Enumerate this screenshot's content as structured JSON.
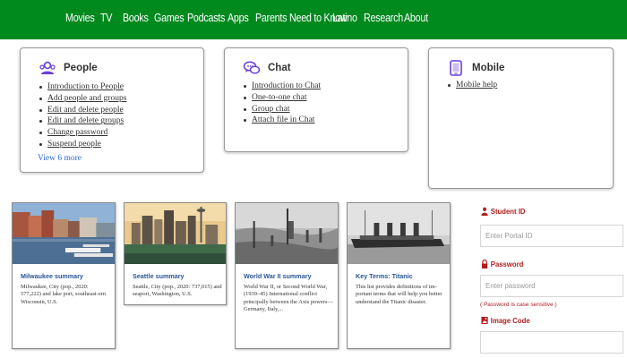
{
  "nav": {
    "items": [
      "Movies",
      "TV",
      "Books",
      "Games",
      "Podcasts",
      "Apps",
      "Parents Need to Know",
      "Latino",
      "Research",
      "About"
    ],
    "background": "#008a1e"
  },
  "help_cards": [
    {
      "title": "People",
      "icon": "people-icon",
      "links": [
        "Introduction to People",
        "Add people and groups",
        "Edit and delete people",
        "Edit and delete groups",
        "Change password",
        "Suspend people"
      ],
      "more": "View 6 more"
    },
    {
      "title": "Chat",
      "icon": "chat-icon",
      "links": [
        "Introduction to Chat",
        "One-to-one chat",
        "Group chat",
        "Attach file in Chat"
      ]
    },
    {
      "title": "Mobile",
      "icon": "mobile-icon",
      "links": [
        "Mobile help"
      ]
    }
  ],
  "articles": [
    {
      "title": "Milwaukee summary",
      "desc": "Milwaukee, City (pop., 2020: 577,222) and lake port, southeast-ern Wisconsin, U.S.",
      "image": "milwaukee-harbor-photo"
    },
    {
      "title": "Seattle summary",
      "desc": "Seattle, City (pop., 2020: 737,015) and seaport, Washington, U.S.",
      "image": "seattle-skyline-photo"
    },
    {
      "title": "World War II summary",
      "desc": "World War II, or Second World War, (1939–45) International conflict principally between the Axis powers—Germany, Italy,...",
      "image": "wwii-soldiers-photo"
    },
    {
      "title": "Key Terms: Titanic",
      "desc": "This list provides definitions of im-portant terms that will help you better understand the Titanic disaster.",
      "image": "titanic-ship-photo"
    }
  ],
  "login": {
    "student_id_label": "Student ID",
    "student_id_placeholder": "Enter Portal ID",
    "password_label": "Password",
    "password_placeholder": "Enter password",
    "password_note": "( Password is case sensitive )",
    "image_code_label": "Image Code"
  },
  "colors": {
    "accent_red": "#b01d1d",
    "link_blue": "#2a6ad6",
    "icon_purple": "#6a3fd6"
  }
}
